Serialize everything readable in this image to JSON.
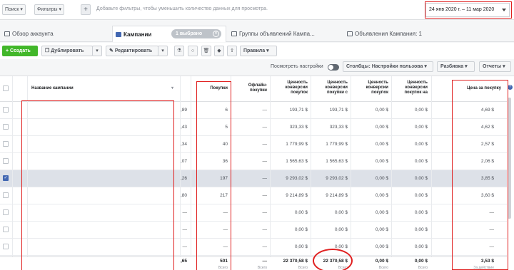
{
  "topbar": {
    "search_label": "Поиск ▾",
    "filters_label": "Фильтры ▾",
    "add_label": "+",
    "hint": "Добавьте фильтры, чтобы уменьшить количество данных для просмотра.",
    "date_range": "24 янв 2020 г. – 11 мар 2020"
  },
  "tabs": {
    "overview": "Обзор аккаунта",
    "campaigns": "Кампании",
    "selected": "1 выбрано",
    "adsets": "Группы объявлений Кампа...",
    "ads": "Объявления Кампания: 1"
  },
  "toolbar": {
    "create": "+ Создать",
    "duplicate": "Дублировать",
    "edit": "Редактировать",
    "rules": "Правила"
  },
  "controls": {
    "view_settings": "Посмотреть настройки",
    "columns": "Столбцы: Настройки пользова",
    "breakdown": "Разбивка",
    "reports": "Отчеты"
  },
  "columns": {
    "name": "Название кампании",
    "purchases": "Покупки",
    "offline": [
      "Офлайн-",
      "покупки"
    ],
    "value_purchase": [
      "Ценность",
      "конверсии",
      "покупок"
    ],
    "value_purchase_c": [
      "Ценность",
      "конверсии",
      "покупки с"
    ],
    "value_purchase_3": [
      "Ценность",
      "конверсии",
      "покупок"
    ],
    "value_purchase_4": [
      "Ценность",
      "конверсии",
      "покупок на"
    ],
    "price_per_purchase": "Цена за покупку"
  },
  "rows": [
    {
      "cut": ",89",
      "purchases": "6",
      "offline": "—",
      "v1": "193,71 $",
      "v2": "193,71 $",
      "v3": "0,00 $",
      "v4": "0,00 $",
      "price": "4,69 $",
      "selected": false
    },
    {
      "cut": ",43",
      "purchases": "5",
      "offline": "—",
      "v1": "323,33 $",
      "v2": "323,33 $",
      "v3": "0,00 $",
      "v4": "0,00 $",
      "price": "4,62 $",
      "selected": false
    },
    {
      "cut": ",34",
      "purchases": "40",
      "offline": "—",
      "v1": "1 779,99 $",
      "v2": "1 779,99 $",
      "v3": "0,00 $",
      "v4": "0,00 $",
      "price": "2,57 $",
      "selected": false
    },
    {
      "cut": ",07",
      "purchases": "36",
      "offline": "—",
      "v1": "1 565,63 $",
      "v2": "1 565,63 $",
      "v3": "0,00 $",
      "v4": "0,00 $",
      "price": "2,06 $",
      "selected": false
    },
    {
      "cut": ",26",
      "purchases": "197",
      "offline": "—",
      "v1": "9 293,02 $",
      "v2": "9 293,02 $",
      "v3": "0,00 $",
      "v4": "0,00 $",
      "price": "3,85 $",
      "selected": true
    },
    {
      "cut": ",80",
      "purchases": "217",
      "offline": "—",
      "v1": "9 214,89 $",
      "v2": "9 214,89 $",
      "v3": "0,00 $",
      "v4": "0,00 $",
      "price": "3,60 $",
      "selected": false
    },
    {
      "cut": "—",
      "purchases": "—",
      "offline": "—",
      "v1": "0,00 $",
      "v2": "0,00 $",
      "v3": "0,00 $",
      "v4": "0,00 $",
      "price": "—",
      "selected": false
    },
    {
      "cut": "—",
      "purchases": "—",
      "offline": "—",
      "v1": "0,00 $",
      "v2": "0,00 $",
      "v3": "0,00 $",
      "v4": "0,00 $",
      "price": "—",
      "selected": false
    },
    {
      "cut": "—",
      "purchases": "—",
      "offline": "—",
      "v1": "0,00 $",
      "v2": "0,00 $",
      "v3": "0,00 $",
      "v4": "0,00 $",
      "price": "—",
      "selected": false
    }
  ],
  "totals": {
    "cut": ",65",
    "purchases": "501",
    "purchases_sub": "Всего",
    "offline": "—",
    "offline_sub": "Всего",
    "v1": "22 370,58 $",
    "v1_sub": "Всего",
    "v2": "22 370,58 $",
    "v2_sub": "Всего",
    "v3": "0,00 $",
    "v3_sub": "Всего",
    "v4": "0,00 $",
    "v4_sub": "Всего",
    "price": "3,53 $",
    "price_sub": "За действие"
  },
  "colors": {
    "accent": "#4267b2",
    "highlight": "#e02020",
    "create": "#42b72a"
  }
}
